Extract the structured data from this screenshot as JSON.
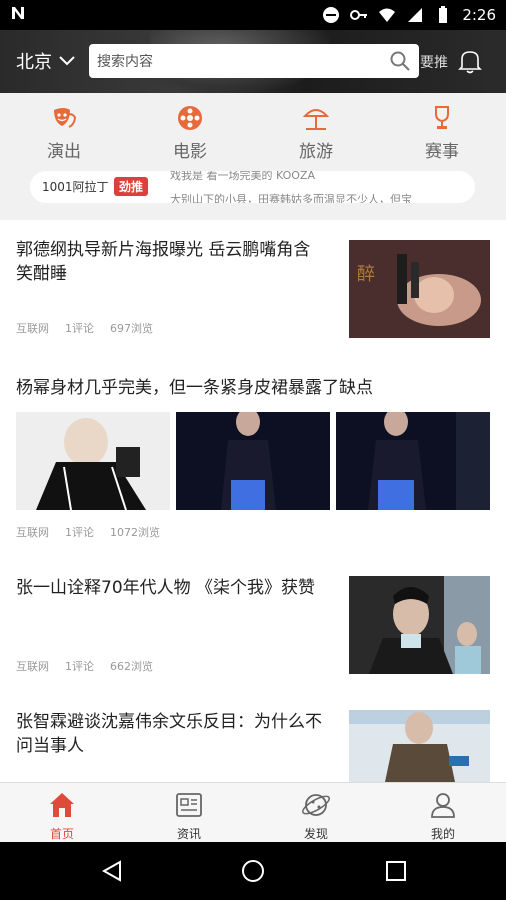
{
  "status_bar": {
    "time": "2:26"
  },
  "header": {
    "city": "北京",
    "search_placeholder": "搜索内容",
    "side_text": "要推"
  },
  "categories": [
    {
      "label": "演出",
      "icon": "theater-mask-icon"
    },
    {
      "label": "电影",
      "icon": "film-reel-icon"
    },
    {
      "label": "旅游",
      "icon": "beach-umbrella-icon"
    },
    {
      "label": "赛事",
      "icon": "trophy-icon"
    }
  ],
  "ticker": {
    "source": "1001阿拉丁",
    "badge": "劲推",
    "line1": "戏我是 看一场完美的 KOOZA",
    "line2": "大别山下的小县，田赛韩姑多而温显不少人，但宝"
  },
  "articles": [
    {
      "title": "郭德纲执导新片海报曝光 岳云鹏嘴角含笑酣睡",
      "source": "互联网",
      "comments": "1评论",
      "views": "697浏览"
    },
    {
      "title": "杨幂身材几乎完美，但一条紧身皮裙暴露了缺点",
      "source": "互联网",
      "comments": "1评论",
      "views": "1072浏览"
    },
    {
      "title": "张一山诠释70年代人物 《柒个我》获赞",
      "source": "互联网",
      "comments": "1评论",
      "views": "662浏览"
    },
    {
      "title": "张智霖避谈沈嘉伟余文乐反目：为什么不问当事人"
    }
  ],
  "bottom_nav": [
    {
      "label": "首页",
      "icon": "home-icon",
      "active": true
    },
    {
      "label": "资讯",
      "icon": "news-icon",
      "active": false
    },
    {
      "label": "发现",
      "icon": "planet-icon",
      "active": false
    },
    {
      "label": "我的",
      "icon": "user-icon",
      "active": false
    }
  ],
  "colors": {
    "accent": "#e04a3b",
    "category_bg": "#f1f1f1",
    "badge": "#d9413a"
  }
}
